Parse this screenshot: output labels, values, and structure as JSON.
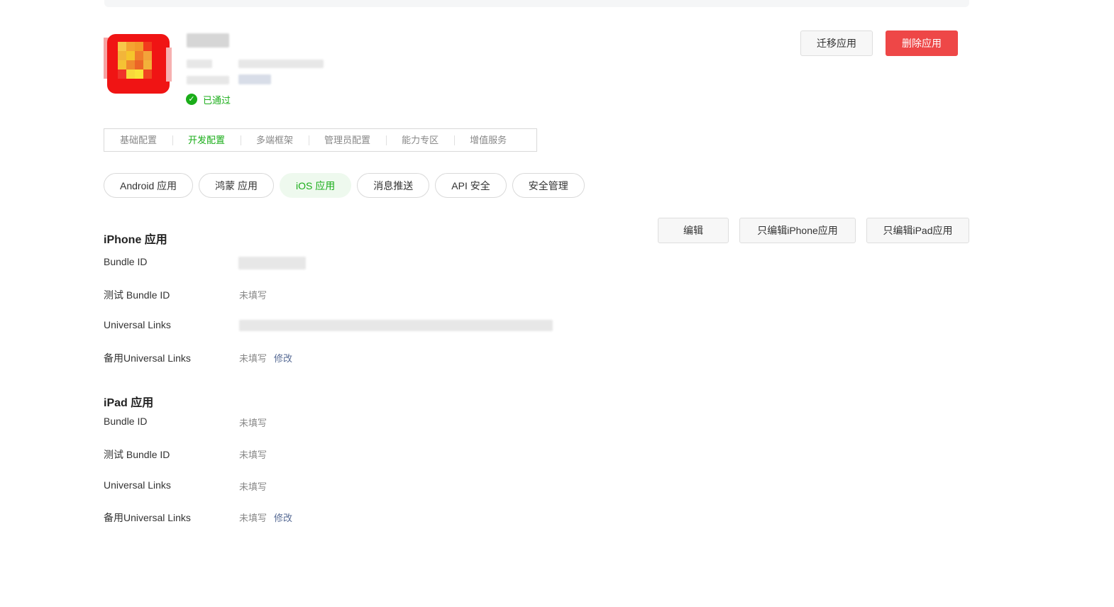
{
  "app": {
    "status": "已通过"
  },
  "actions": {
    "migrate": "迁移应用",
    "delete": "删除应用"
  },
  "tabs": [
    {
      "label": "基础配置",
      "active": false
    },
    {
      "label": "开发配置",
      "active": true
    },
    {
      "label": "多端框架",
      "active": false
    },
    {
      "label": "管理员配置",
      "active": false
    },
    {
      "label": "能力专区",
      "active": false
    },
    {
      "label": "增值服务",
      "active": false
    }
  ],
  "subtabs": [
    {
      "label": "Android 应用",
      "active": false
    },
    {
      "label": "鸿蒙 应用",
      "active": false
    },
    {
      "label": "iOS 应用",
      "active": true
    },
    {
      "label": "消息推送",
      "active": false
    },
    {
      "label": "API 安全",
      "active": false
    },
    {
      "label": "安全管理",
      "active": false
    }
  ],
  "edit_buttons": {
    "edit": "编辑",
    "edit_iphone": "只编辑iPhone应用",
    "edit_ipad": "只编辑iPad应用"
  },
  "iphone": {
    "title": "iPhone 应用",
    "rows": {
      "bundle_id": {
        "label": "Bundle ID"
      },
      "test_bundle_id": {
        "label": "测试 Bundle ID",
        "value": "未填写"
      },
      "universal_links": {
        "label": "Universal Links"
      },
      "backup_universal_links": {
        "label": "备用Universal Links",
        "value": "未填写",
        "action": "修改"
      }
    }
  },
  "ipad": {
    "title": "iPad 应用",
    "rows": {
      "bundle_id": {
        "label": "Bundle ID",
        "value": "未填写"
      },
      "test_bundle_id": {
        "label": "测试 Bundle ID",
        "value": "未填写"
      },
      "universal_links": {
        "label": "Universal Links",
        "value": "未填写"
      },
      "backup_universal_links": {
        "label": "备用Universal Links",
        "value": "未填写",
        "action": "修改"
      }
    }
  },
  "colors": {
    "brand_green": "#1aad19",
    "danger_red": "#ee4747",
    "link_blue": "#576b95",
    "icon_red": "#f01414"
  }
}
